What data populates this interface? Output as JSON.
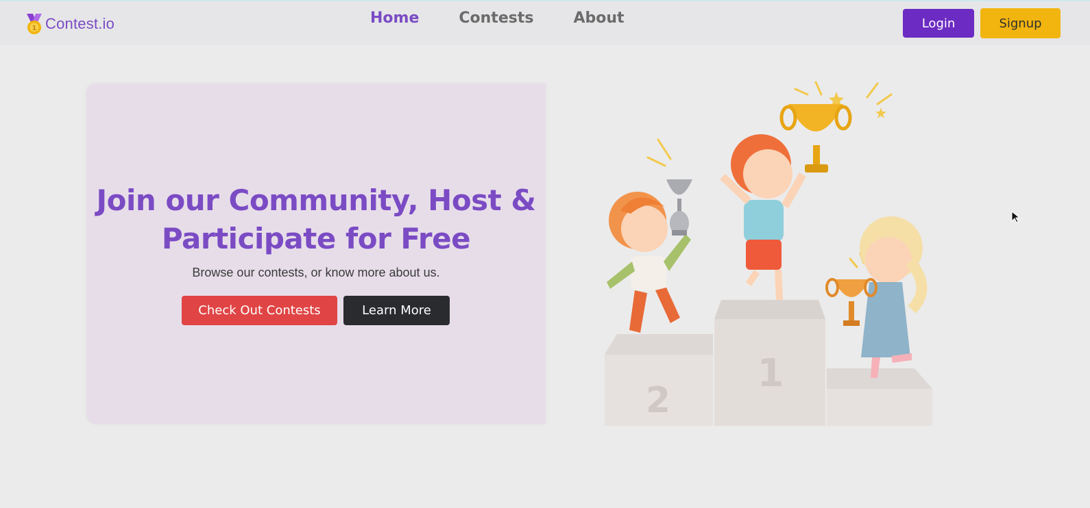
{
  "brand": {
    "name": "Contest.io",
    "accent": "#7b4bc4",
    "logo_icon": "medal-icon"
  },
  "nav": {
    "links": [
      {
        "label": "Home",
        "active": true
      },
      {
        "label": "Contests",
        "active": false
      },
      {
        "label": "About",
        "active": false
      }
    ]
  },
  "auth": {
    "login_label": "Login",
    "login_color": "#6c2bc2",
    "signup_label": "Signup",
    "signup_color": "#f2b40f"
  },
  "hero": {
    "title_line1": "Join our Community, Host &",
    "title_line2": "Participate for Free",
    "subtitle": "Browse our contests, or know more about us.",
    "primary_button": "Check Out Contests",
    "secondary_button": "Learn More",
    "illustration": "kids-podium-trophies-illustration"
  },
  "colors": {
    "primary_button": "#e04444",
    "secondary_button": "#2a2b2f",
    "card_bg": "#e7dde9"
  }
}
